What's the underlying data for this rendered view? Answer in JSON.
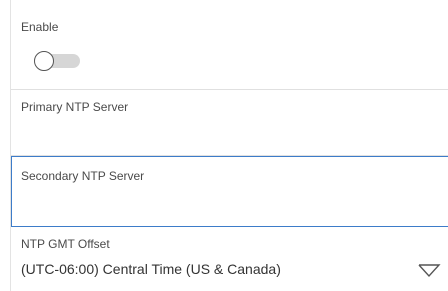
{
  "enable": {
    "label": "Enable",
    "toggle_on": false
  },
  "primary_ntp": {
    "label": "Primary NTP Server",
    "value": ""
  },
  "secondary_ntp": {
    "label": "Secondary NTP Server",
    "value": ""
  },
  "gmt_offset": {
    "label": "NTP GMT Offset",
    "selected": "(UTC-06:00) Central Time (US & Canada)",
    "icon": "chevron-down-icon"
  }
}
